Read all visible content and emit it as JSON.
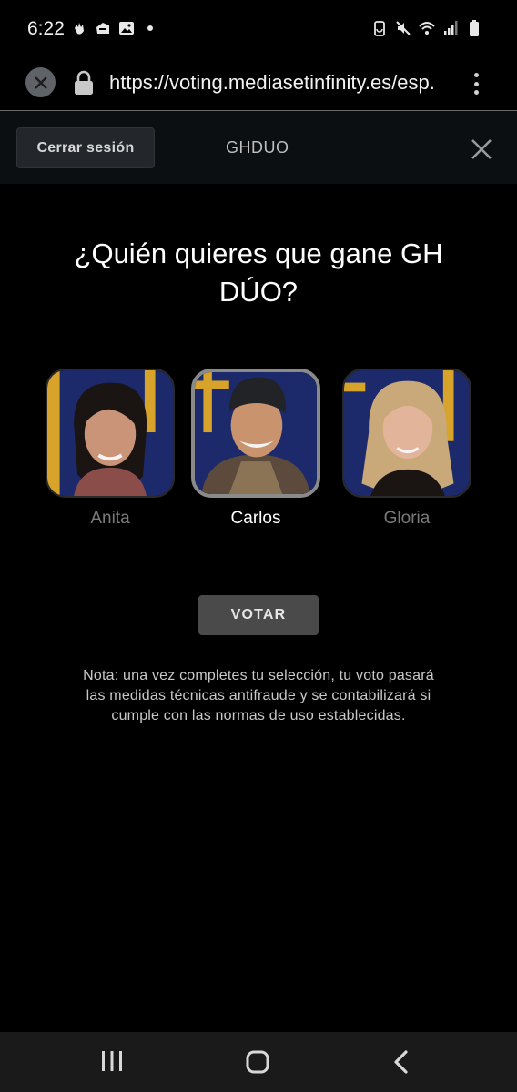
{
  "status_bar": {
    "time": "6:22",
    "left_icons": [
      "hand-icon",
      "notification-icon",
      "image-icon",
      "dot-icon"
    ],
    "right_icons": [
      "battery-saver-icon",
      "mute-icon",
      "wifi-icon",
      "signal-icon",
      "battery-icon"
    ]
  },
  "browser": {
    "url": "https://voting.mediasetinfinity.es/esp."
  },
  "header": {
    "logout_label": "Cerrar sesión",
    "title": "GHDUO"
  },
  "main": {
    "question": "¿Quién quieres que gane GH DÚO?",
    "candidates": [
      {
        "name": "Anita",
        "selected": false
      },
      {
        "name": "Carlos",
        "selected": true
      },
      {
        "name": "Gloria",
        "selected": false
      }
    ],
    "vote_label": "VOTAR",
    "note": "Nota: una vez completes tu selección, tu voto pasará las medidas técnicas antifraude y se contabilizará si cumple con las normas de uso establecidas."
  },
  "colors": {
    "background": "#000000",
    "header_bg": "#0b0f12",
    "vote_button": "#4a4a4a",
    "photo_bg": "#1c2a6b",
    "photo_accent": "#d8a32a"
  }
}
